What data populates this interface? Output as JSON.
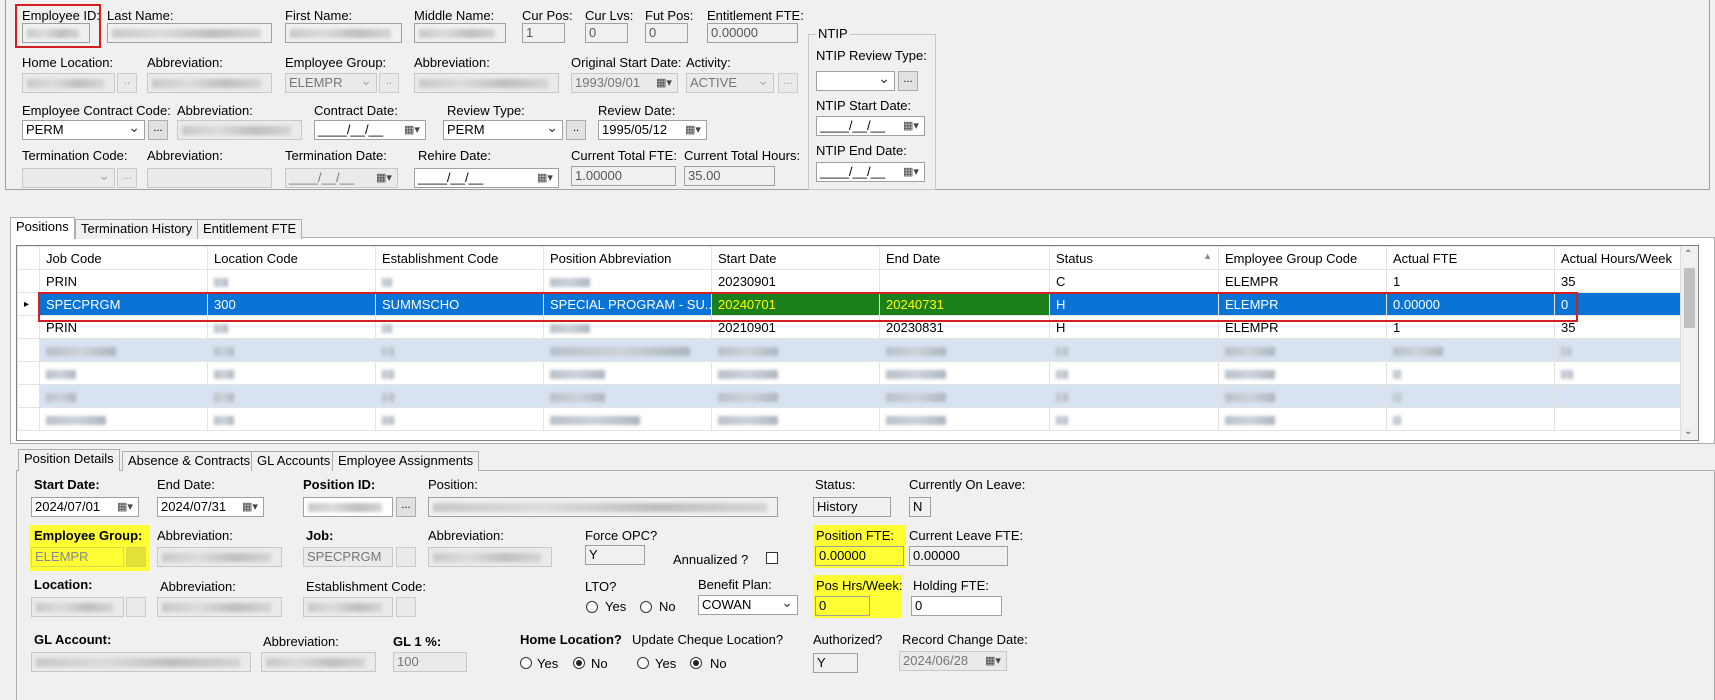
{
  "header": {
    "employee_id": {
      "label": "Employee ID:"
    },
    "last_name": {
      "label": "Last Name:"
    },
    "first_name": {
      "label": "First Name:"
    },
    "middle_name": {
      "label": "Middle Name:"
    },
    "cur_pos": {
      "label": "Cur Pos:",
      "value": "1"
    },
    "cur_lvs": {
      "label": "Cur Lvs:",
      "value": "0"
    },
    "fut_pos": {
      "label": "Fut Pos:",
      "value": "0"
    },
    "entitlement_fte": {
      "label": "Entitlement FTE:",
      "value": "0.00000"
    },
    "home_location": {
      "label": "Home Location:"
    },
    "abbreviation_label": "Abbreviation:",
    "employee_group": {
      "label": "Employee Group:",
      "value": "ELEMPR"
    },
    "original_start_date": {
      "label": "Original Start Date:",
      "value": "1993/09/01"
    },
    "activity": {
      "label": "Activity:",
      "value": "ACTIVE"
    },
    "contract_code": {
      "label": "Employee Contract Code:",
      "value": "PERM"
    },
    "contract_date": {
      "label": "Contract Date:",
      "value": "____/__/__"
    },
    "review_type": {
      "label": "Review Type:",
      "value": "PERM"
    },
    "review_date": {
      "label": "Review Date:",
      "value": "1995/05/12"
    },
    "termination_code": {
      "label": "Termination Code:"
    },
    "termination_date": {
      "label": "Termination Date:",
      "value": "____/__/__"
    },
    "rehire_date": {
      "label": "Rehire Date:",
      "value": "____/__/__"
    },
    "current_total_fte": {
      "label": "Current Total FTE:",
      "value": "1.00000"
    },
    "current_total_hours": {
      "label": "Current Total Hours:",
      "value": "35.00"
    },
    "ellipsis": "...",
    "double_dot": ".."
  },
  "ntip": {
    "title": "NTIP",
    "review_type_label": "NTIP Review Type:",
    "start_date_label": "NTIP Start Date:",
    "start_date_value": "____/__/__",
    "end_date_label": "NTIP End Date:",
    "end_date_value": "____/__/__"
  },
  "tabs_top": [
    "Positions",
    "Termination History",
    "Entitlement FTE"
  ],
  "grid": {
    "columns": [
      "Job Code",
      "Location Code",
      "Establishment Code",
      "Position Abbreviation",
      "Start Date",
      "End Date",
      "Status",
      "Employee Group Code",
      "Actual FTE",
      "Actual Hours/Week"
    ],
    "sort_indicator": "▲",
    "row_pointer": "▸",
    "rows": [
      [
        "PRIN",
        "",
        "",
        "",
        "20230901",
        "",
        "C",
        "ELEMPR",
        "1",
        "35"
      ],
      [
        "SPECPRGM",
        "300",
        "SUMMSCHO",
        "SPECIAL PROGRAM - SU...",
        "20240701",
        "20240731",
        "H",
        "ELEMPR",
        "0.00000",
        "0"
      ],
      [
        "PRIN",
        "",
        "",
        "",
        "20210901",
        "20230831",
        "H",
        "ELEMPR",
        "1",
        "35"
      ]
    ]
  },
  "tabs_bottom": [
    "Position Details",
    "Absence & Contracts",
    "GL Accounts",
    "Employee Assignments"
  ],
  "details": {
    "start_date": {
      "label": "Start Date:",
      "value": "2024/07/01"
    },
    "end_date": {
      "label": "End Date:",
      "value": "2024/07/31"
    },
    "position_id": {
      "label": "Position ID:"
    },
    "position": {
      "label": "Position:"
    },
    "status": {
      "label": "Status:",
      "value": "History"
    },
    "currently_on_leave": {
      "label": "Currently On Leave:",
      "value": "N"
    },
    "employee_group": {
      "label": "Employee Group:",
      "value": "ELEMPR"
    },
    "abbreviation_label": "Abbreviation:",
    "job": {
      "label": "Job:",
      "value": "SPECPRGM"
    },
    "force_opc": {
      "label": "Force OPC?",
      "value": "Y"
    },
    "annualized": {
      "label": "Annualized ?"
    },
    "position_fte": {
      "label": "Position FTE:",
      "value": "0.00000"
    },
    "current_leave_fte": {
      "label": "Current Leave FTE:",
      "value": "0.00000"
    },
    "location": {
      "label": "Location:"
    },
    "establishment_code": {
      "label": "Establishment Code:"
    },
    "lto": {
      "label": "LTO?",
      "yes": "Yes",
      "no": "No"
    },
    "benefit_plan": {
      "label": "Benefit Plan:",
      "value": "COWAN"
    },
    "pos_hrs_week": {
      "label": "Pos Hrs/Week:",
      "value": "0"
    },
    "holding_fte": {
      "label": "Holding FTE:",
      "value": "0"
    },
    "gl_account": {
      "label": "GL Account:"
    },
    "gl_1_pct": {
      "label": "GL 1 %:",
      "value": "100"
    },
    "home_location": {
      "label": "Home Location?",
      "yes": "Yes",
      "no": "No"
    },
    "update_cheque_location": {
      "label": "Update Cheque Location?",
      "yes": "Yes",
      "no": "No"
    },
    "authorized": {
      "label": "Authorized?",
      "value": "Y"
    },
    "record_change_date": {
      "label": "Record Change Date:",
      "value": "2024/06/28"
    }
  }
}
